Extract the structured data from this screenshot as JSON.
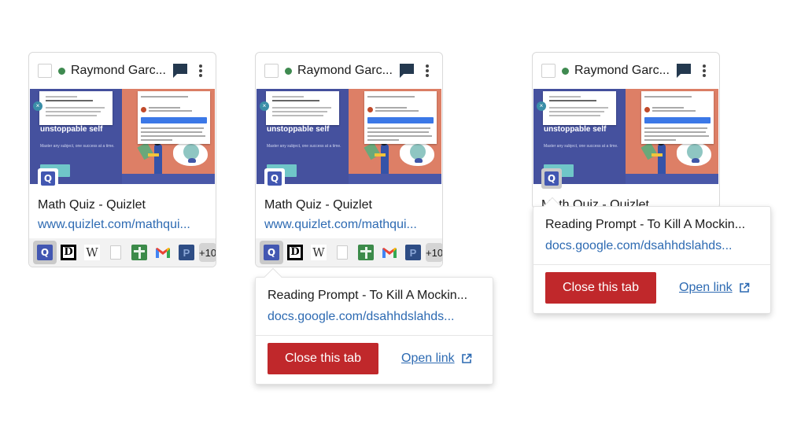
{
  "cards": [
    {
      "student_name": "Raymond Garc...",
      "status": "online",
      "status_color": "#3f8a50",
      "thumbnail": {
        "headline": "unstoppable self",
        "subline": "Master any subject, one success at a time."
      },
      "tab_title": "Math Quiz - Quizlet",
      "tab_url": "www.quizlet.com/mathqui...",
      "tabs": [
        "quizlet-icon",
        "d-icon",
        "wikipedia-icon",
        "blank-document-icon",
        "google-classroom-icon",
        "gmail-icon",
        "p-icon"
      ],
      "more_tabs": "+10"
    },
    {
      "student_name": "Raymond Garc...",
      "status": "online",
      "status_color": "#3f8a50",
      "thumbnail": {
        "headline": "unstoppable self",
        "subline": "Master any subject, one success at a time."
      },
      "tab_title": "Math Quiz - Quizlet",
      "tab_url": "www.quizlet.com/mathqui...",
      "tabs": [
        "quizlet-icon",
        "d-icon",
        "wikipedia-icon",
        "blank-document-icon",
        "google-classroom-icon",
        "gmail-icon",
        "p-icon"
      ],
      "more_tabs": "+10"
    },
    {
      "student_name": "Raymond Garc...",
      "status": "online",
      "status_color": "#3f8a50",
      "thumbnail": {
        "headline": "unstoppable self",
        "subline": "Master any subject, one success at a time."
      },
      "tab_title": "Math Quiz - Quizlet"
    }
  ],
  "popovers": [
    {
      "title": "Reading Prompt - To Kill A Mockin...",
      "url": "docs.google.com/dsahhdslahds...",
      "close_label": "Close this tab",
      "open_label": "Open link"
    },
    {
      "title": "Reading Prompt - To Kill A Mockin...",
      "url": "docs.google.com/dsahhdslahds...",
      "close_label": "Close this tab",
      "open_label": "Open link"
    }
  ],
  "icons": {
    "quizlet_glyph": "Q",
    "d_glyph": "D",
    "wiki_glyph": "W",
    "p_glyph": "P",
    "close_glyph": "×"
  },
  "colors": {
    "accent_link": "#2d6ab2",
    "danger_button": "#c0282b",
    "quizlet_brand": "#4257b2",
    "online": "#3f8a50"
  }
}
